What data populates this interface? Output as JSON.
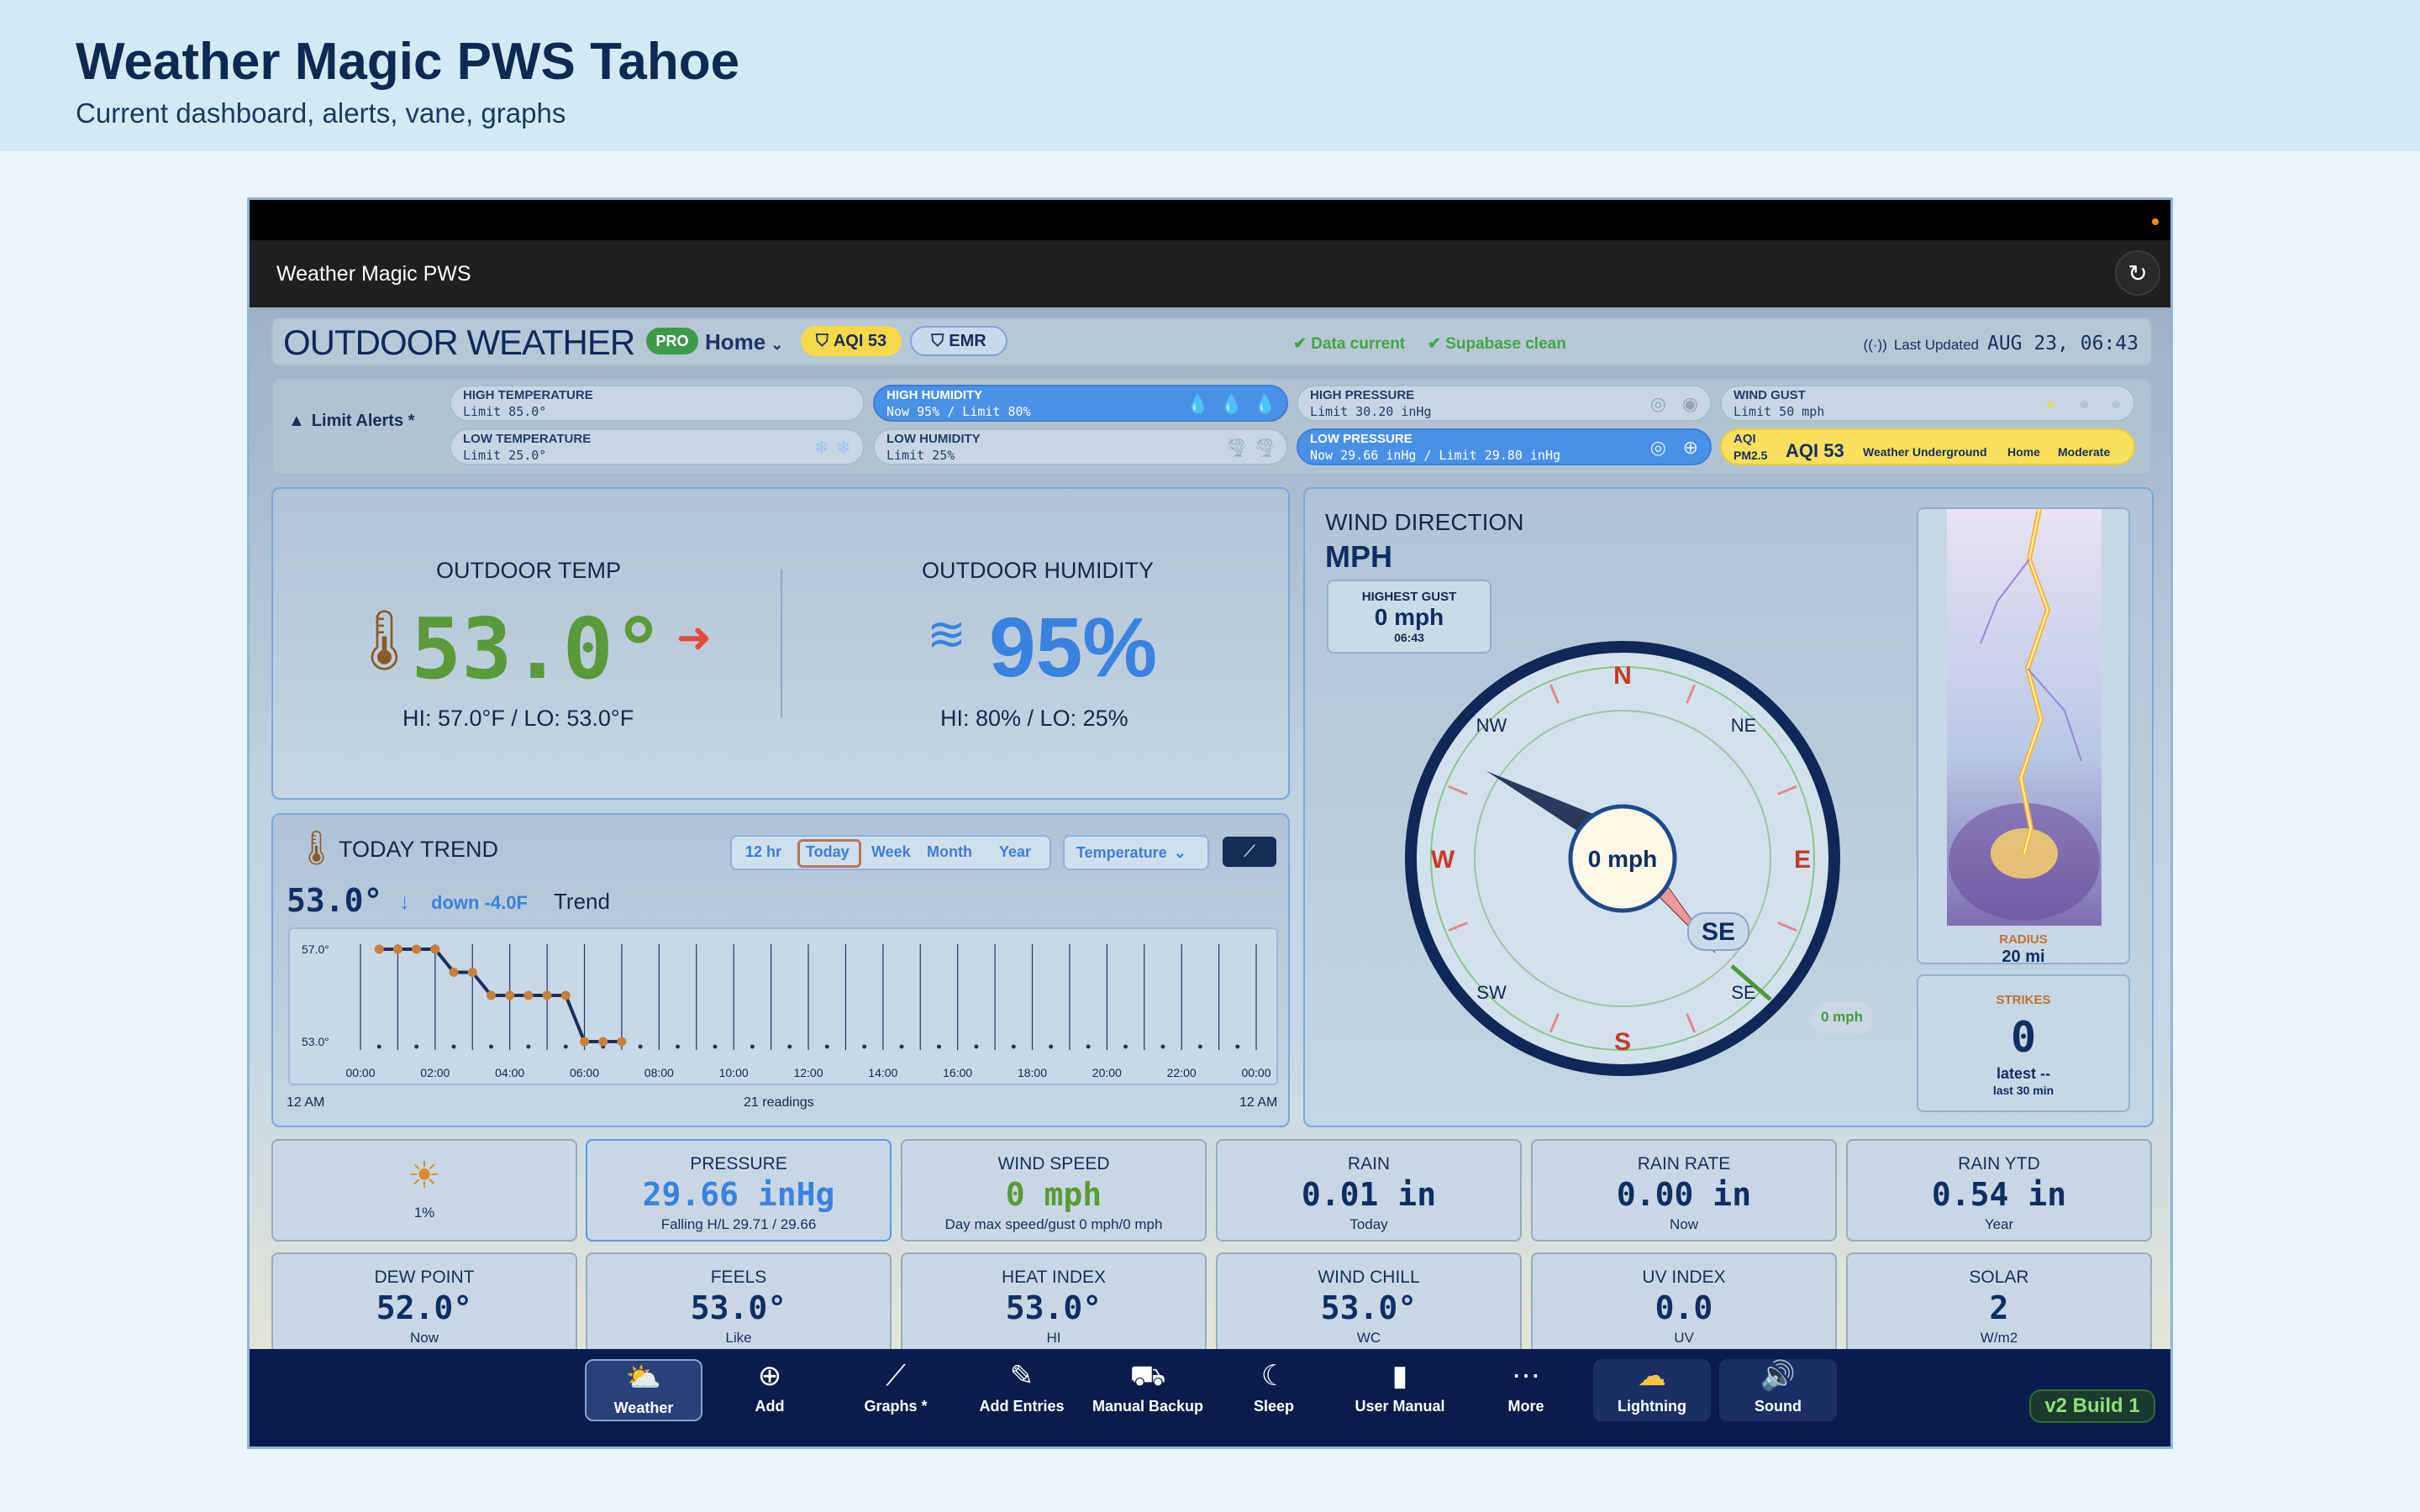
{
  "header": {
    "title": "Weather Magic PWS Tahoe",
    "subtitle": "Current dashboard, alerts, vane, graphs"
  },
  "window": {
    "app_title": "Weather Magic PWS"
  },
  "status_bar": {
    "heading": "OUTDOOR WEATHER",
    "pro_badge": "PRO",
    "location": "Home",
    "aqi_badge": "AQI 53",
    "emr_badge": "EMR",
    "data_current": "Data current",
    "supabase_clean": "Supabase clean",
    "last_updated_label": "Last Updated",
    "last_updated_value": "AUG 23, 06:43"
  },
  "alerts": {
    "label": "Limit Alerts *",
    "high_temp": {
      "title": "HIGH TEMPERATURE",
      "value": "Limit 85.0°"
    },
    "low_temp": {
      "title": "LOW TEMPERATURE",
      "value": "Limit 25.0°"
    },
    "high_humidity": {
      "title": "HIGH HUMIDITY",
      "value": "Now 95% / Limit 80%"
    },
    "low_humidity": {
      "title": "LOW HUMIDITY",
      "value": "Limit 25%"
    },
    "high_pressure": {
      "title": "HIGH PRESSURE",
      "value": "Limit 30.20 inHg"
    },
    "low_pressure": {
      "title": "LOW PRESSURE",
      "value": "Now 29.66 inHg / Limit 29.80 inHg"
    },
    "wind_gust": {
      "title": "WIND GUST",
      "value": "Limit 50 mph"
    },
    "aqi": {
      "title": "AQI",
      "pm": "PM2.5",
      "value": "AQI 53",
      "source": "Weather Underground",
      "location": "Home",
      "level": "Moderate"
    }
  },
  "outdoor": {
    "temp_label": "OUTDOOR TEMP",
    "temp_value": "53.0°",
    "temp_hilo": "HI: 57.0°F / LO: 53.0°F",
    "hum_label": "OUTDOOR HUMIDITY",
    "hum_value": "95%",
    "hum_hilo": "HI: 80% / LO: 25%"
  },
  "trend": {
    "title": "TODAY TREND",
    "ranges": [
      "12 hr",
      "Today",
      "Week",
      "Month",
      "Year"
    ],
    "selected_range": "Today",
    "metric": "Temperature",
    "current_value": "53.0°",
    "change": "down -4.0F",
    "trend_label": "Trend",
    "start_label": "12 AM",
    "readings": "21 readings",
    "end_label": "12 AM"
  },
  "chart_data": {
    "type": "line",
    "title": "TODAY TREND",
    "y_tick_labels": [
      "57.0°",
      "53.0°"
    ],
    "x_tick_labels": [
      "00:00",
      "02:00",
      "04:00",
      "06:00",
      "08:00",
      "10:00",
      "12:00",
      "14:00",
      "16:00",
      "18:00",
      "20:00",
      "22:00",
      "00:00"
    ],
    "ylim": [
      53,
      57
    ],
    "x_unit": "hours",
    "series": [
      {
        "x": [
          0.5,
          1,
          1.5,
          2,
          2.5,
          3,
          3.5,
          4,
          4.5,
          5,
          5.5,
          6,
          6.5,
          7
        ],
        "values": [
          57,
          57,
          57,
          57,
          56,
          56,
          55,
          55,
          55,
          55,
          55,
          53,
          53,
          53
        ],
        "color": "#1c2f62"
      }
    ]
  },
  "wind": {
    "title": "WIND DIRECTION",
    "unit": "MPH",
    "gust_label": "HIGHEST GUST",
    "gust_value": "0 mph",
    "gust_time": "06:43",
    "center_speed": "0 mph",
    "direction": "SE",
    "side_speed": "0 mph",
    "compass": {
      "n": "N",
      "ne": "NE",
      "e": "E",
      "se": "SE",
      "s": "S",
      "sw": "SW",
      "w": "W",
      "nw": "NW"
    }
  },
  "lightning": {
    "radius_label": "RADIUS",
    "radius_value": "20 mi",
    "strikes_label": "STRIKES",
    "strikes_value": "0",
    "latest": "latest --",
    "window": "last 30 min"
  },
  "tiles": [
    {
      "title": "",
      "value": "",
      "sub": "1%"
    },
    {
      "title": "PRESSURE",
      "value": "29.66 inHg",
      "sub": "Falling H/L 29.71 / 29.66"
    },
    {
      "title": "WIND SPEED",
      "value": "0 mph",
      "sub": "Day max speed/gust 0 mph/0 mph"
    },
    {
      "title": "RAIN",
      "value": "0.01 in",
      "sub": "Today"
    },
    {
      "title": "RAIN RATE",
      "value": "0.00 in",
      "sub": "Now"
    },
    {
      "title": "RAIN YTD",
      "value": "0.54 in",
      "sub": "Year"
    },
    {
      "title": "DEW POINT",
      "value": "52.0°",
      "sub": "Now"
    },
    {
      "title": "FEELS",
      "value": "53.0°",
      "sub": "Like"
    },
    {
      "title": "HEAT INDEX",
      "value": "53.0°",
      "sub": "HI"
    },
    {
      "title": "WIND CHILL",
      "value": "53.0°",
      "sub": "WC"
    },
    {
      "title": "UV INDEX",
      "value": "0.0",
      "sub": "UV"
    },
    {
      "title": "SOLAR",
      "value": "2",
      "sub": "W/m2"
    }
  ],
  "nav": [
    {
      "label": "Weather",
      "icon": "sun-cloud-icon"
    },
    {
      "label": "Add",
      "icon": "plus-circle-icon"
    },
    {
      "label": "Graphs *",
      "icon": "chart-line-icon"
    },
    {
      "label": "Add Entries",
      "icon": "edit-icon"
    },
    {
      "label": "Manual Backup",
      "icon": "car-icon"
    },
    {
      "label": "Sleep",
      "icon": "moon-icon"
    },
    {
      "label": "User Manual",
      "icon": "book-icon"
    },
    {
      "label": "More",
      "icon": "more-icon"
    },
    {
      "label": "Lightning",
      "icon": "lightning-cloud-icon"
    },
    {
      "label": "Sound",
      "icon": "speaker-icon"
    }
  ],
  "build": "v2 Build 1",
  "colors": {
    "temp": "#5a9a3a",
    "humidity": "#3a82e0",
    "nav_bg": "#0b1b4d",
    "alert_blue": "#4a90e8",
    "alert_yellow": "#f7e05e"
  }
}
